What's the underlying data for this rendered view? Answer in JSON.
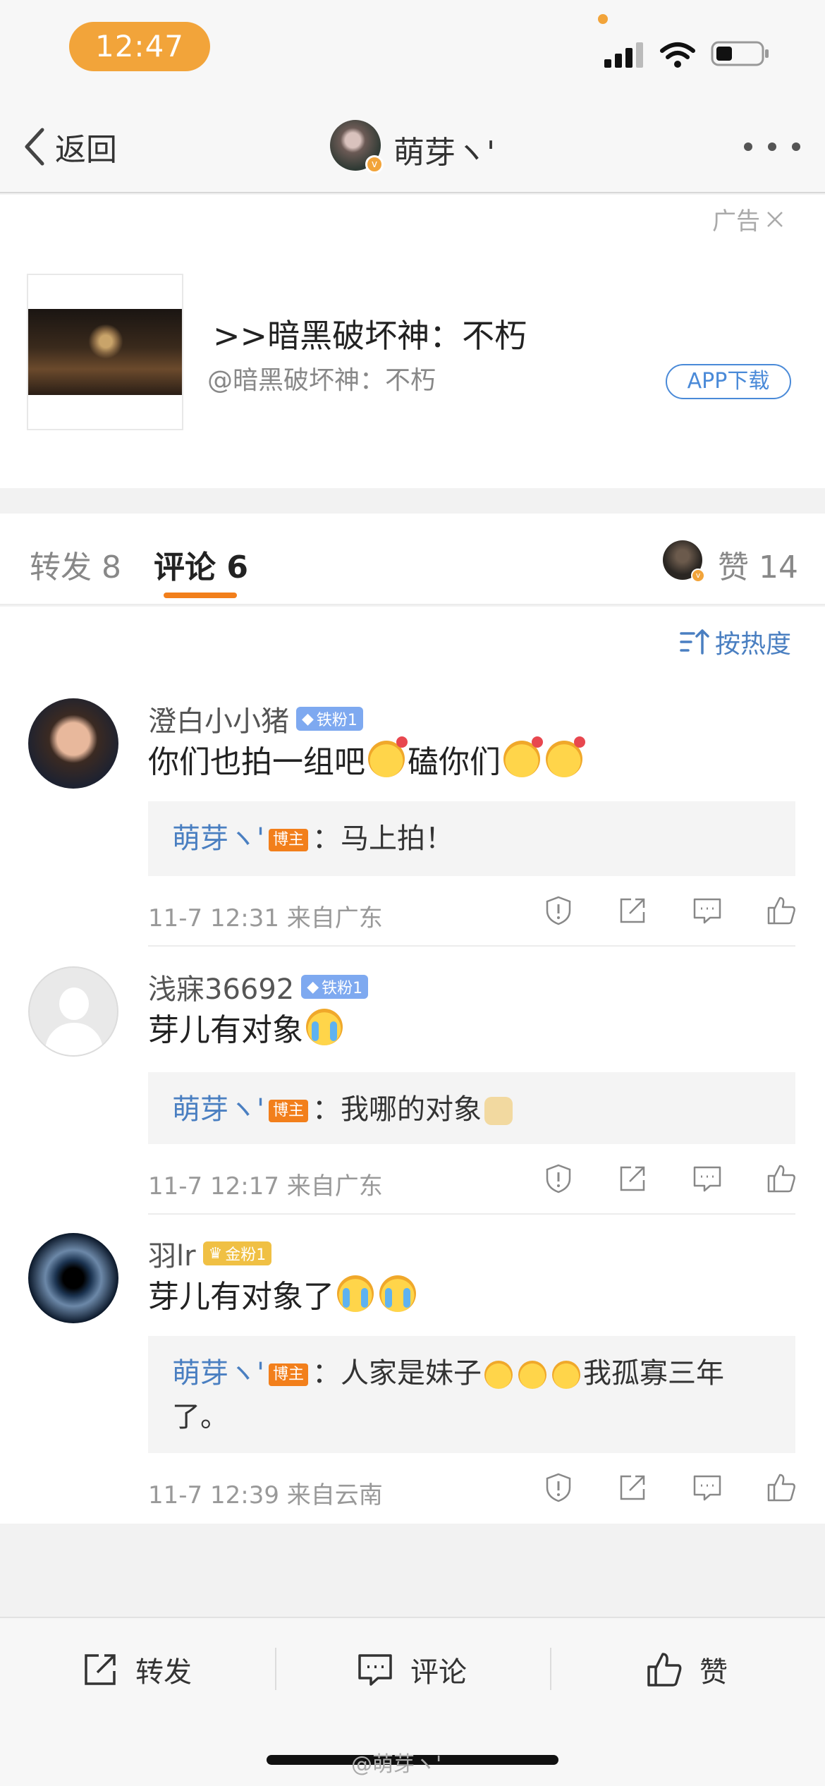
{
  "status_bar": {
    "time": "12:47"
  },
  "nav": {
    "back_label": "返回",
    "title": "萌芽ヽ'"
  },
  "ad": {
    "label": "广告",
    "title": ">>暗黑破坏神：不朽",
    "subtitle": "@暗黑破坏神：不朽",
    "button": "APP下载"
  },
  "tabs": {
    "repost": "转发 8",
    "comment": "评论 6",
    "like": "赞 14"
  },
  "sort_label": "按热度",
  "comments": [
    {
      "name": "澄白小小猪",
      "fan_badge": "铁粉1",
      "text_a": "你们也拍一组吧",
      "text_b": "磕你们",
      "reply_author": "萌芽ヽ'",
      "reply_badge": "博主",
      "reply_text": "：马上拍！",
      "meta": "11-7 12:31 来自广东"
    },
    {
      "name": "浅寐36692",
      "fan_badge": "铁粉1",
      "text_a": "芽儿有对象",
      "reply_author": "萌芽ヽ'",
      "reply_badge": "博主",
      "reply_text": "：我哪的对象",
      "meta": "11-7 12:17 来自广东"
    },
    {
      "name": "羽lr",
      "fan_badge": "金粉1",
      "text_a": "芽儿有对象了",
      "reply_author": "萌芽ヽ'",
      "reply_badge": "博主",
      "reply_text_a": "：人家是妹子",
      "reply_text_b": "我孤寡三年了。",
      "meta": "11-7 12:39 来自云南"
    }
  ],
  "bottom_bar": {
    "repost": "转发",
    "comment": "评论",
    "like": "赞"
  },
  "watermark": "@萌芽ヽ'",
  "colors": {
    "accent": "#f27f1b",
    "link": "#4a7fc1",
    "time_pill": "#f2a43a"
  }
}
